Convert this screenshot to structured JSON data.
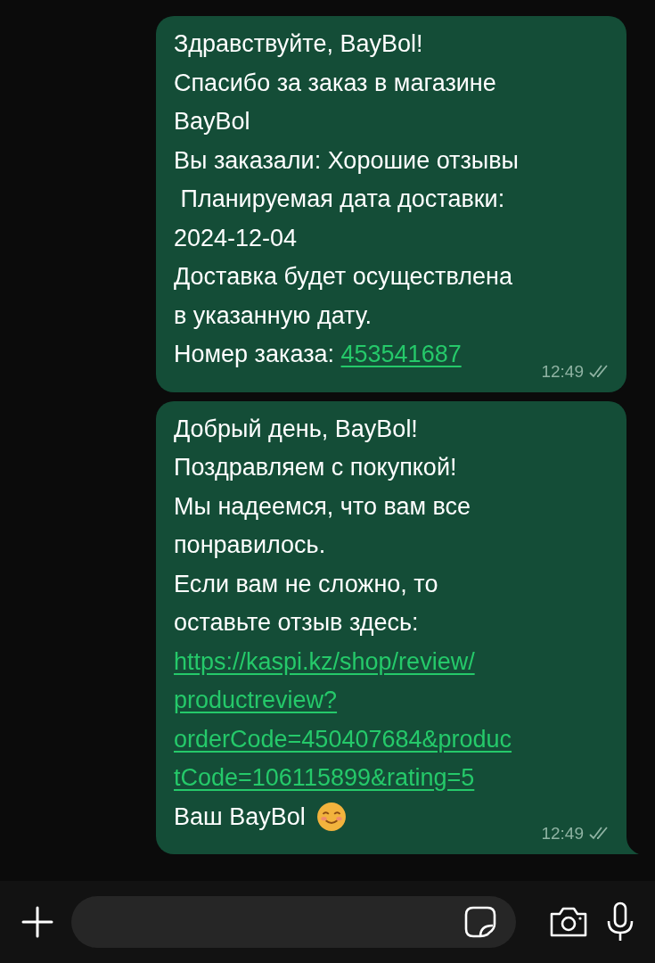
{
  "messages": [
    {
      "lines": [
        {
          "text": "Здравствуйте, BayBol!"
        },
        {
          "text": "Спасибо за заказ в магазине"
        },
        {
          "text": "BayBol"
        },
        {
          "text": "Вы заказали: Хорошие отзывы"
        },
        {
          "text": " Планируемая дата доставки:"
        },
        {
          "text": "2024-12-04"
        },
        {
          "text": "Доставка будет осуществлена"
        },
        {
          "text": "в указанную дату."
        },
        {
          "text": "Номер заказа: ",
          "link": "453541687"
        }
      ],
      "time": "12:49",
      "delivered": true,
      "tail": false
    },
    {
      "lines": [
        {
          "text": "Добрый день, BayBol!"
        },
        {
          "text": "Поздравляем с покупкой!"
        },
        {
          "text": "Мы надеемся, что вам все"
        },
        {
          "text": "понравилось."
        },
        {
          "text": "Если вам не сложно, то"
        },
        {
          "text": "оставьте отзыв здесь:"
        },
        {
          "link": "https://kaspi.kz/shop/review/"
        },
        {
          "link": "productreview?"
        },
        {
          "link": "orderCode=450407684&produc"
        },
        {
          "link": "tCode=106115899&rating=5"
        },
        {
          "text": "Ваш BayBol",
          "emoji": true
        }
      ],
      "time": "12:49",
      "delivered": true,
      "tail": true
    }
  ]
}
